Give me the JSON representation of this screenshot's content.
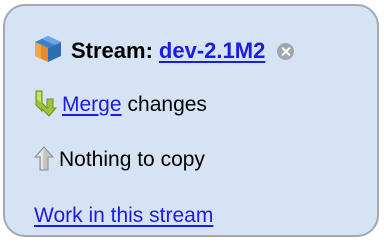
{
  "stream": {
    "label": "Stream:",
    "name": "dev-2.1M2",
    "icon": "stream-cube-icon",
    "close_icon": "close-icon"
  },
  "merge": {
    "icon": "merge-arrow-icon",
    "link_label": "Merge",
    "suffix": "changes"
  },
  "copy": {
    "icon": "copy-up-arrow-icon",
    "text": "Nothing to copy"
  },
  "work": {
    "link_label": "Work in this stream"
  },
  "colors": {
    "panel_background": "#d5e3f5",
    "panel_border": "#a4a9ae",
    "link": "#1c1ce0",
    "merge_arrow": "#9bc43a",
    "copy_arrow": "#b9b9b9"
  }
}
